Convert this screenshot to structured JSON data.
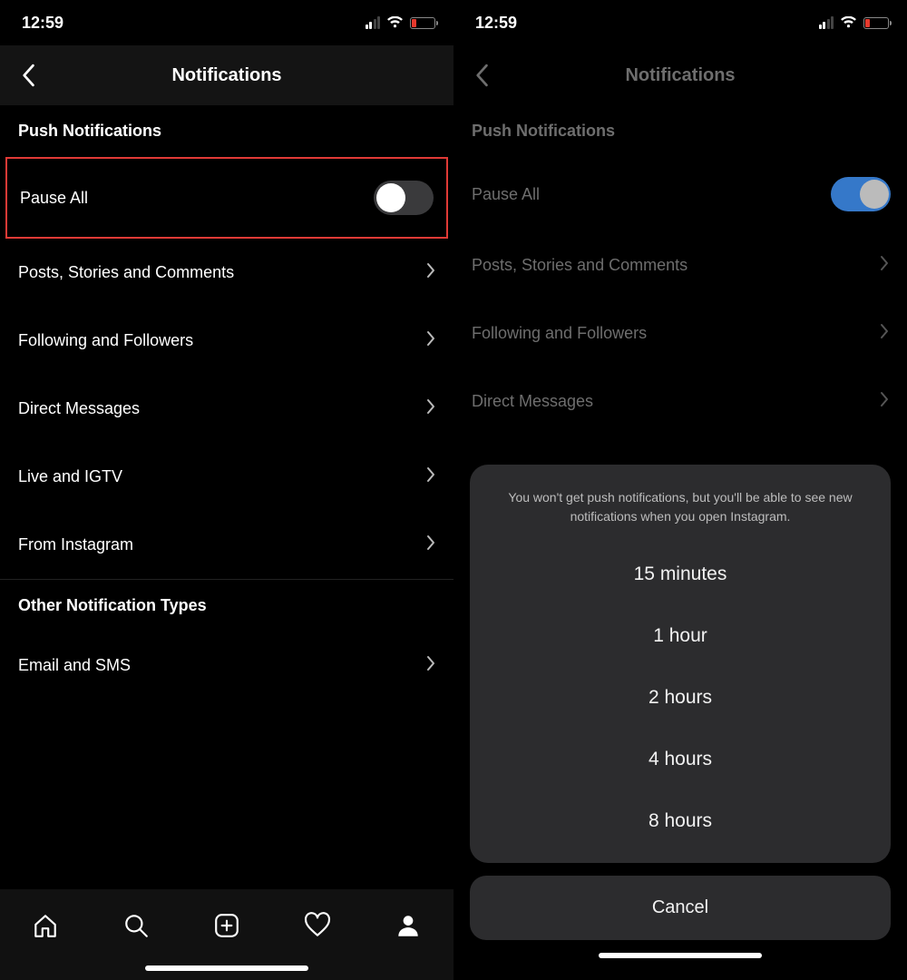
{
  "status": {
    "time": "12:59"
  },
  "left": {
    "header_title": "Notifications",
    "section1_title": "Push Notifications",
    "pause_all_label": "Pause All",
    "items": [
      "Posts, Stories and Comments",
      "Following and Followers",
      "Direct Messages",
      "Live and IGTV",
      "From Instagram"
    ],
    "section2_title": "Other Notification Types",
    "items2": [
      "Email and SMS"
    ]
  },
  "right": {
    "header_title": "Notifications",
    "section1_title": "Push Notifications",
    "pause_all_label": "Pause All",
    "items": [
      "Posts, Stories and Comments",
      "Following and Followers",
      "Direct Messages"
    ],
    "sheet_desc": "You won't get push notifications, but you'll be able to see new notifications when you open Instagram.",
    "sheet_options": [
      "15 minutes",
      "1 hour",
      "2 hours",
      "4 hours",
      "8 hours"
    ],
    "cancel_label": "Cancel"
  }
}
